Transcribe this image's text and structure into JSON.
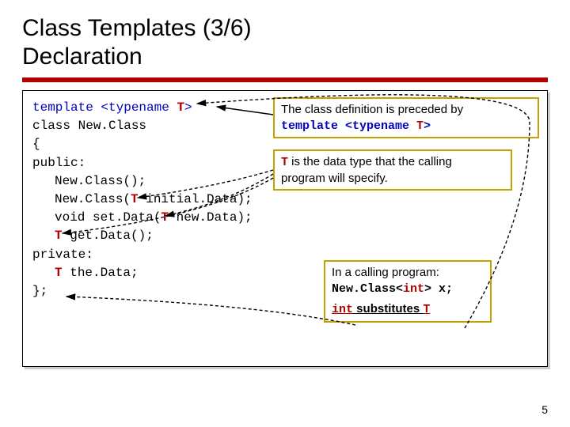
{
  "slide": {
    "title_line1": "Class Templates (3/6)",
    "title_line2": "Declaration",
    "page_number": "5"
  },
  "code": {
    "l1a": "template <typename ",
    "l1c": ">",
    "l2": "class New.Class",
    "l3": "{",
    "l4": "public:",
    "l5": "New.Class();",
    "l6a": "New.Class(",
    "l6c": " initial.Data);",
    "l7a": "void set.Data(",
    "l7c": " new.Data);",
    "l8c": " get.Data();",
    "l9": "",
    "l10": "private:",
    "l11c": " the.Data;",
    "l12": "};",
    "T": "T"
  },
  "callouts": {
    "c1a": "The class definition is preceded by",
    "c1b": "template <typename ",
    "c1d": ">",
    "c2b": " is the data type that the calling",
    "c2c": "program will specify.",
    "c3a": "In a calling program:",
    "c3b_left": "New.Class<",
    "c3b_mid": "int",
    "c3b_right": "> x;",
    "c3c_left": "int",
    "c3c_mid": " substitutes ",
    "c3c_right": "T"
  }
}
